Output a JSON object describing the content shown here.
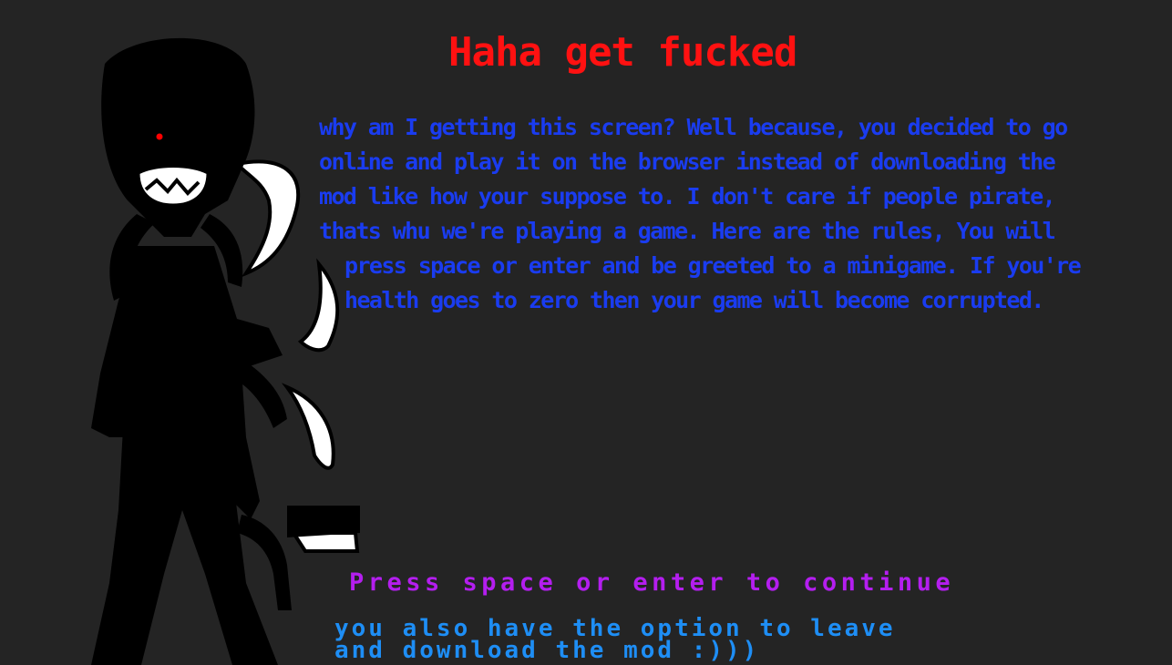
{
  "screen": {
    "title": "Haha get fucked",
    "message_lines": [
      "why am I getting this screen? Well because, you decided to go",
      "online and play it on the browser instead of downloading the",
      "mod like how your suppose to. I don't care if people pirate,",
      "thats whu we're playing a game. Here are the rules, You will",
      "press space or enter and be greeted to a minigame. If you're",
      "health goes to zero then your game will become corrupted."
    ],
    "prompt": "Press space or enter to continue",
    "option_note_lines": [
      "you also have the option to leave",
      "and download the mod :)))"
    ]
  },
  "colors": {
    "background": "#242424",
    "title": "#ff1111",
    "message": "#1a3cf0",
    "prompt": "#b41eef",
    "option_note": "#1e8ef5",
    "character_eye": "#ff0000"
  },
  "icons": {
    "character": "shadow-creature-sprite"
  }
}
